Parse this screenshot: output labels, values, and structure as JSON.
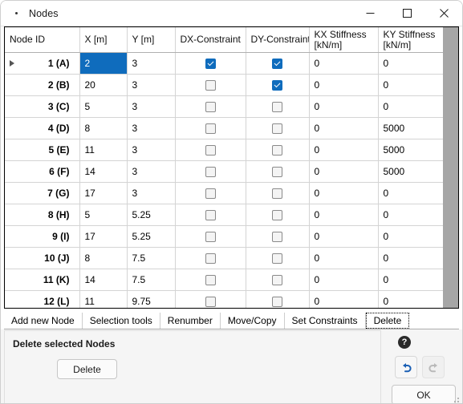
{
  "window": {
    "title": "Nodes",
    "icon": "app-dot-icon",
    "controls": {
      "minimize": "minimize-icon",
      "maximize": "maximize-icon",
      "close": "close-icon"
    }
  },
  "table": {
    "columns": [
      {
        "line1": "Node ID",
        "line2": ""
      },
      {
        "line1": "X [m]",
        "line2": ""
      },
      {
        "line1": "Y [m]",
        "line2": ""
      },
      {
        "line1": "DX-Constraint",
        "line2": ""
      },
      {
        "line1": "DY-Constraint",
        "line2": ""
      },
      {
        "line1": "KX Stiffness",
        "line2": "[kN/m]"
      },
      {
        "line1": "KY Stiffness",
        "line2": "[kN/m]"
      }
    ],
    "selected_cell": {
      "row": 0,
      "column": 1
    },
    "current_row_indicator": 0,
    "rows": [
      {
        "node_id": "1 (A)",
        "x": "2",
        "y": "3",
        "dx": true,
        "dy": true,
        "kx": "0",
        "ky": "0"
      },
      {
        "node_id": "2 (B)",
        "x": "20",
        "y": "3",
        "dx": false,
        "dy": true,
        "kx": "0",
        "ky": "0"
      },
      {
        "node_id": "3 (C)",
        "x": "5",
        "y": "3",
        "dx": false,
        "dy": false,
        "kx": "0",
        "ky": "0"
      },
      {
        "node_id": "4 (D)",
        "x": "8",
        "y": "3",
        "dx": false,
        "dy": false,
        "kx": "0",
        "ky": "5000"
      },
      {
        "node_id": "5 (E)",
        "x": "11",
        "y": "3",
        "dx": false,
        "dy": false,
        "kx": "0",
        "ky": "5000"
      },
      {
        "node_id": "6 (F)",
        "x": "14",
        "y": "3",
        "dx": false,
        "dy": false,
        "kx": "0",
        "ky": "5000"
      },
      {
        "node_id": "7 (G)",
        "x": "17",
        "y": "3",
        "dx": false,
        "dy": false,
        "kx": "0",
        "ky": "0"
      },
      {
        "node_id": "8 (H)",
        "x": "5",
        "y": "5.25",
        "dx": false,
        "dy": false,
        "kx": "0",
        "ky": "0"
      },
      {
        "node_id": "9 (I)",
        "x": "17",
        "y": "5.25",
        "dx": false,
        "dy": false,
        "kx": "0",
        "ky": "0"
      },
      {
        "node_id": "10 (J)",
        "x": "8",
        "y": "7.5",
        "dx": false,
        "dy": false,
        "kx": "0",
        "ky": "0"
      },
      {
        "node_id": "11 (K)",
        "x": "14",
        "y": "7.5",
        "dx": false,
        "dy": false,
        "kx": "0",
        "ky": "0"
      },
      {
        "node_id": "12 (L)",
        "x": "11",
        "y": "9.75",
        "dx": false,
        "dy": false,
        "kx": "0",
        "ky": "0"
      }
    ]
  },
  "tabs": [
    {
      "label": "Add new Node",
      "active": false
    },
    {
      "label": "Selection tools",
      "active": false
    },
    {
      "label": "Renumber",
      "active": false
    },
    {
      "label": "Move/Copy",
      "active": false
    },
    {
      "label": "Set Constraints",
      "active": false
    },
    {
      "label": "Delete",
      "active": true
    }
  ],
  "panel": {
    "title": "Delete selected Nodes",
    "delete_label": "Delete"
  },
  "actions": {
    "help": "?",
    "undo": "undo-icon",
    "redo": "redo-icon",
    "ok_label": "OK"
  },
  "colors": {
    "accent": "#0f6cbd",
    "undo_enabled": "#1a5fb4",
    "redo_disabled": "#b9b9b9",
    "grid_filler": "#a6a6a6"
  }
}
